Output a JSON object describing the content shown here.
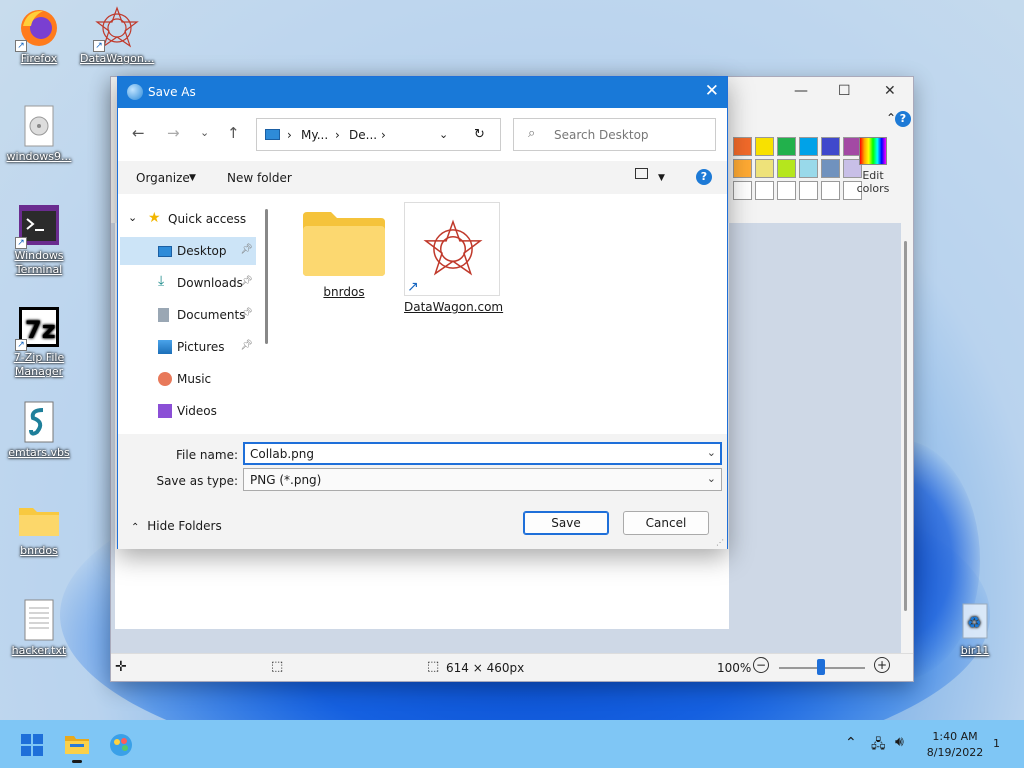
{
  "desktop": {
    "icons": [
      {
        "label": "Firefox"
      },
      {
        "label": "DataWagon..."
      },
      {
        "label": "windows9..."
      },
      {
        "label": "Windows Terminal"
      },
      {
        "label": "7-Zip File Manager"
      },
      {
        "label": "emtars.vbs"
      },
      {
        "label": "bnrdos"
      },
      {
        "label": "hacker.txt"
      },
      {
        "label": "bir11"
      }
    ]
  },
  "paint": {
    "edit_colors": "Edit colors",
    "palette": [
      "#f26a2a",
      "#f8e100",
      "#22b14c",
      "#00a2e8",
      "#3f48cc",
      "#a349a4",
      "#ffaa33",
      "#eee27a",
      "#b5e61d",
      "#99d9ea",
      "#7092be",
      "#c8bfe7"
    ],
    "status": {
      "size": "614 × 460px",
      "zoom": "100%"
    }
  },
  "dialog": {
    "title": "Save As",
    "breadcrumb": [
      "My...",
      "De..."
    ],
    "search_placeholder": "Search Desktop",
    "toolbar": {
      "organize": "Organize",
      "new_folder": "New folder",
      "help": "?"
    },
    "nav": [
      {
        "label": "Quick access",
        "pinned": false
      },
      {
        "label": "Desktop",
        "pinned": true
      },
      {
        "label": "Downloads",
        "pinned": true
      },
      {
        "label": "Documents",
        "pinned": true
      },
      {
        "label": "Pictures",
        "pinned": true
      },
      {
        "label": "Music",
        "pinned": false
      },
      {
        "label": "Videos",
        "pinned": false
      }
    ],
    "files": [
      {
        "name": "bnrdos",
        "type": "folder"
      },
      {
        "name": "DataWagon.com",
        "type": "shortcut"
      }
    ],
    "file_name_label": "File name:",
    "file_name_value": "Collab.png",
    "save_type_label": "Save as type:",
    "save_type_value": "PNG (*.png)",
    "hide_folders": "Hide Folders",
    "save_button": "Save",
    "cancel_button": "Cancel"
  },
  "taskbar": {
    "time": "1:40 AM",
    "date": "8/19/2022",
    "notification_count": "1"
  }
}
